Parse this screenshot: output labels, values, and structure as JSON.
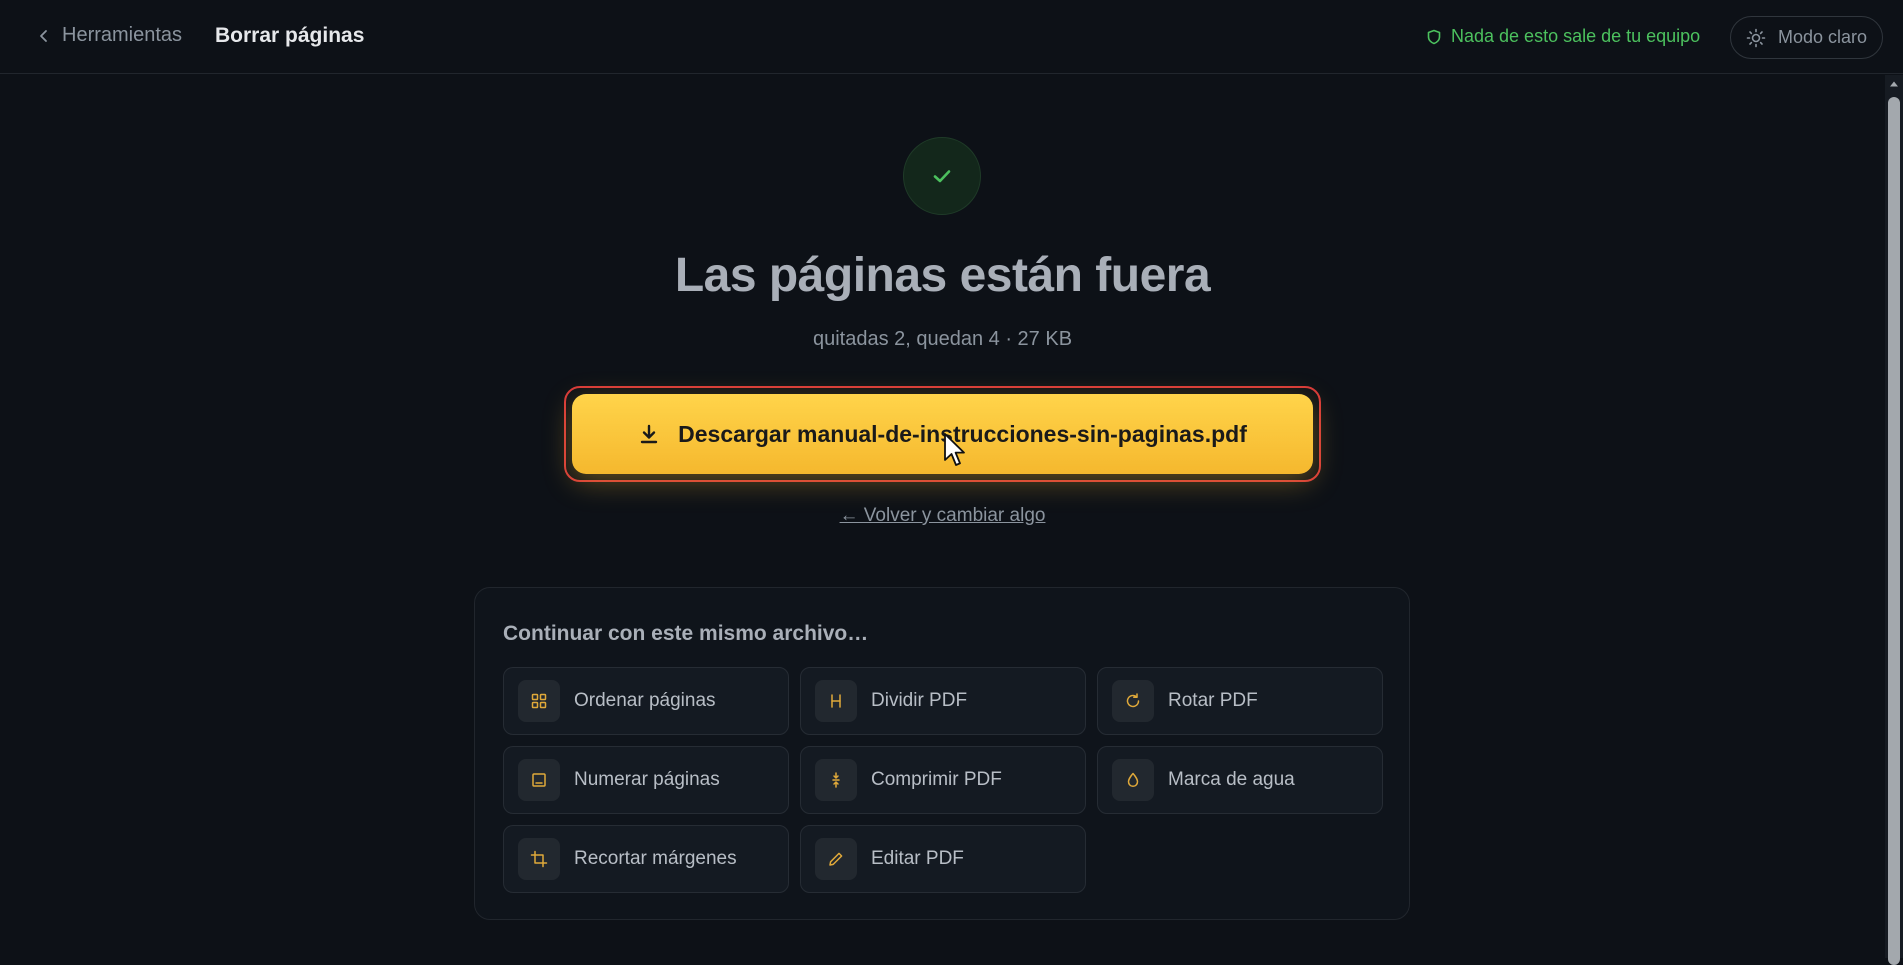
{
  "header": {
    "back_label": "Herramientas",
    "title": "Borrar páginas",
    "privacy_note": "Nada de esto sale de tu equipo",
    "theme_toggle_label": "Modo claro"
  },
  "result": {
    "headline": "Las páginas están fuera",
    "summary": "quitadas 2, quedan 4 · 27 KB",
    "download_label": "Descargar manual-de-instrucciones-sin-paginas.pdf",
    "back_change_label": "← Volver y cambiar algo"
  },
  "continue": {
    "title": "Continuar con este mismo archivo…",
    "tools": [
      {
        "label": "Ordenar páginas",
        "icon": "grid-icon"
      },
      {
        "label": "Dividir PDF",
        "icon": "split-icon"
      },
      {
        "label": "Rotar PDF",
        "icon": "rotate-icon"
      },
      {
        "label": "Numerar páginas",
        "icon": "page-number-icon"
      },
      {
        "label": "Comprimir PDF",
        "icon": "compress-icon"
      },
      {
        "label": "Marca de agua",
        "icon": "droplet-icon"
      },
      {
        "label": "Recortar márgenes",
        "icon": "crop-icon"
      },
      {
        "label": "Editar PDF",
        "icon": "pencil-icon"
      }
    ]
  },
  "colors": {
    "accent": "#f5b82e",
    "success": "#4cc15e",
    "highlight_outline": "#d73a3a",
    "background": "#0d1117"
  }
}
